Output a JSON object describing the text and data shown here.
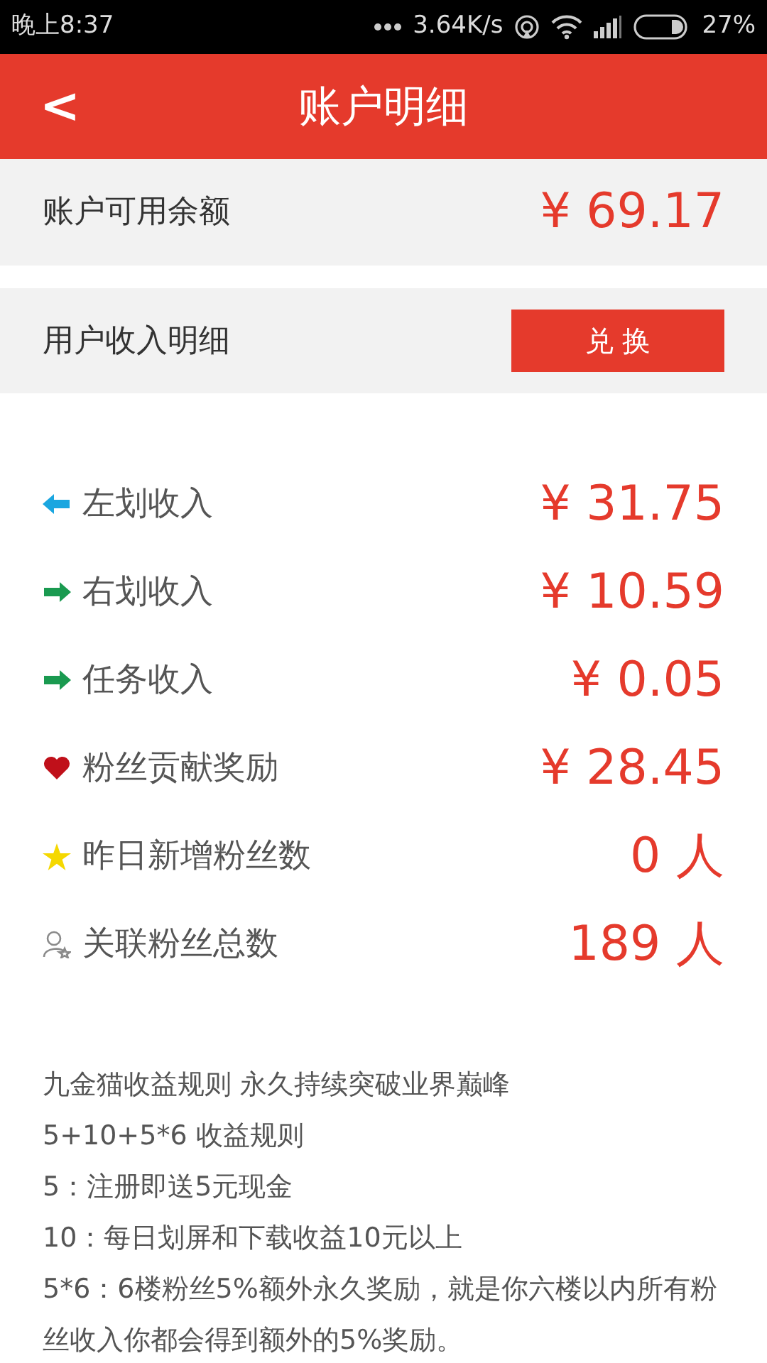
{
  "status_bar": {
    "time": "晚上8:37",
    "speed": "3.64K/s",
    "battery": "27%"
  },
  "header": {
    "back": "<",
    "title": "账户明细"
  },
  "balance": {
    "label": "账户可用余额",
    "amount": "¥ 69.17"
  },
  "income_header": {
    "label": "用户收入明细",
    "button": "兑 换"
  },
  "rows": [
    {
      "kind": "arrow-left",
      "color": "#1aa6e0",
      "label": "左划收入",
      "value": "¥ 31.75"
    },
    {
      "kind": "arrow-right",
      "color": "#1a9a50",
      "label": "右划收入",
      "value": "¥ 10.59"
    },
    {
      "kind": "arrow-right",
      "color": "#1a9a50",
      "label": "任务收入",
      "value": "¥ 0.05"
    },
    {
      "kind": "heart",
      "color": "#c0101a",
      "label": "粉丝贡献奖励",
      "value": "¥ 28.45"
    },
    {
      "kind": "star",
      "color": "#f5d800",
      "label": "昨日新增粉丝数",
      "value": "0 人"
    },
    {
      "kind": "person",
      "color": "#8a8a8a",
      "label": "关联粉丝总数",
      "value": "189 人"
    }
  ],
  "rules": [
    "九金猫收益规则  永久持续突破业界巅峰",
    "5+10+5*6 收益规则",
    "5：注册即送5元现金",
    "10：每日划屏和下载收益10元以上",
    "5*6：6楼粉丝5%额外永久奖励，就是你六楼以内所有粉丝收入你都会得到额外的5%奖励。"
  ]
}
